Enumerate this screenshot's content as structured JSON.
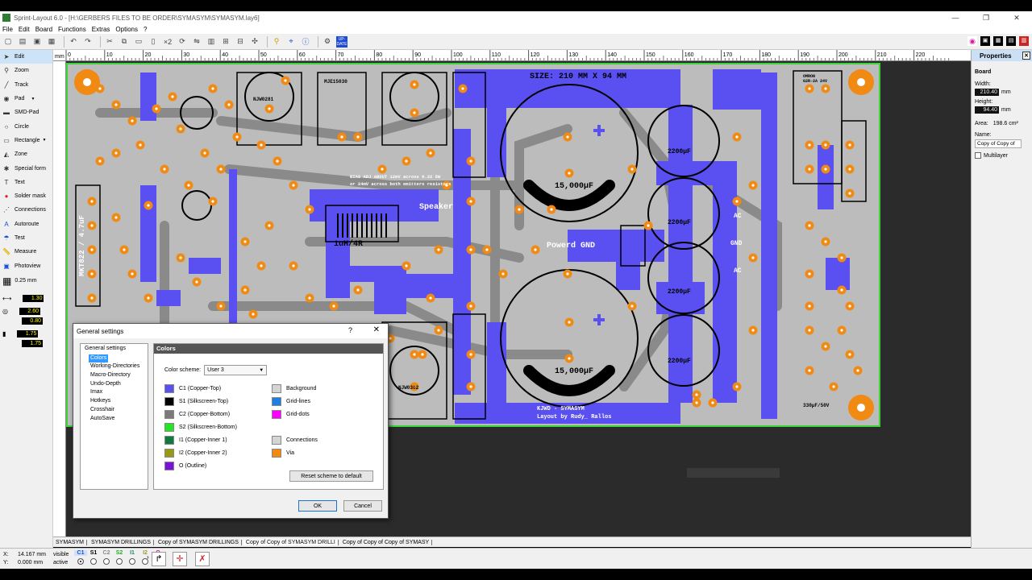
{
  "window": {
    "title": "Sprint-Layout 6.0 - [H:\\GERBERS FILES TO BE ORDER\\SYMASYM\\SYMASYM.lay6]",
    "min": "—",
    "max": "❐",
    "close": "✕"
  },
  "menu": [
    "File",
    "Edit",
    "Board",
    "Functions",
    "Extras",
    "Options",
    "?"
  ],
  "toolbar": {
    "zoom_label": "×2",
    "update_label": "UP-\nDATE"
  },
  "tools": [
    {
      "label": "Edit",
      "icon": "arrow-icon"
    },
    {
      "label": "Zoom",
      "icon": "zoom-icon"
    },
    {
      "label": "Track",
      "icon": "track-icon"
    },
    {
      "label": "Pad",
      "icon": "pad-icon"
    },
    {
      "label": "SMD-Pad",
      "icon": "smd-pad-icon"
    },
    {
      "label": "Circle",
      "icon": "circle-icon"
    },
    {
      "label": "Rectangle",
      "icon": "rectangle-icon"
    },
    {
      "label": "Zone",
      "icon": "zone-icon"
    },
    {
      "label": "Special form",
      "icon": "special-form-icon"
    },
    {
      "label": "Text",
      "icon": "text-icon"
    },
    {
      "label": "Solder mask",
      "icon": "solder-mask-icon"
    },
    {
      "label": "Connections",
      "icon": "connections-icon"
    },
    {
      "label": "Autoroute",
      "icon": "autoroute-icon"
    },
    {
      "label": "Test",
      "icon": "test-icon"
    },
    {
      "label": "Measure",
      "icon": "measure-icon"
    },
    {
      "label": "Photoview",
      "icon": "photoview-icon"
    }
  ],
  "grid": {
    "value": "0.25 mm"
  },
  "track_widths": [
    "1.30",
    "2.60",
    "0.80",
    "1.75",
    "1.75"
  ],
  "ruler": {
    "unit": "mm",
    "ticks": [
      "0",
      "10",
      "20",
      "30",
      "40",
      "50",
      "60",
      "70",
      "80",
      "90",
      "100",
      "110",
      "120",
      "130",
      "140",
      "150",
      "160",
      "170",
      "180",
      "190",
      "200",
      "210",
      "220"
    ]
  },
  "board_texts": {
    "size": "SIZE: 210 MM X 94 MM",
    "cap1": "15,000µF",
    "cap2": "15,000µF",
    "gnd": "Powerd GND",
    "speaker": "Speaker",
    "inductor": "1uH/4R",
    "mkt": "MKT822 / 4.7uF",
    "credit1": "KJWD - SYMASYM",
    "credit2": "Layout by Rudy_ Rallos",
    "c2200a": "2200µF",
    "c2200b": "2200µF",
    "c2200c": "2200µF",
    "c2200d": "2200µF",
    "bias": "BIAS ADJ ABOUT 12mV across 0.22 5W",
    "bias2": "or 24mV across both emitters resistors",
    "ac1": "AC",
    "ac2": "AC",
    "gnd2": "GND",
    "mje": "MJE15030",
    "njw1": "NJW0281",
    "njw2": "NJW0302",
    "cap330": "330µF/50V",
    "relay": "OMRON\nG2R-2A 24V"
  },
  "tabs": [
    "SYMASYM",
    "SYMASYM DRILLINGS",
    "Copy of SYMASYM DRILLINGS",
    "Copy of Copy of SYMASYM DRILLI",
    "Copy of Copy of Copy of SYMASY"
  ],
  "status": {
    "x_label": "X:",
    "x_value": "14.167 mm",
    "y_label": "Y:",
    "y_value": "0.000 mm",
    "visible": "visible",
    "active": "active",
    "layers": [
      "C1",
      "S1",
      "C2",
      "S2",
      "I1",
      "I2",
      "O"
    ],
    "layer_colors": [
      "#1e4fd8",
      "#000000",
      "#888888",
      "#1fb01f",
      "#1e8a5a",
      "#999933",
      "#d4169e"
    ]
  },
  "properties": {
    "title": "Properties",
    "section": "Board",
    "width_label": "Width:",
    "width_value": "210.40",
    "height_label": "Height:",
    "height_value": "94.40",
    "unit": "mm",
    "area_label": "Area:",
    "area_value": "198.6 cm²",
    "name_label": "Name:",
    "name_value": "Copy of Copy of",
    "multilayer_label": "Multilayer"
  },
  "dialog": {
    "title": "General settings",
    "help": "?",
    "close": "✕",
    "tree": [
      "General settings",
      "Colors",
      "Working-Directories",
      "Macro-Directory",
      "Undo-Depth",
      "Imax",
      "Hotkeys",
      "Crosshair",
      "AutoSave"
    ],
    "selected": "Colors",
    "panel_title": "Colors",
    "scheme_label": "Color scheme:",
    "scheme_value": "User 3",
    "colors_left": [
      {
        "label": "C1 (Copper-Top)",
        "color": "#5a4ff0"
      },
      {
        "label": "S1 (Silkscreen-Top)",
        "color": "#000000"
      },
      {
        "label": "C2 (Copper-Bottom)",
        "color": "#7a7a7a"
      },
      {
        "label": "S2 (Silkscreen-Bottom)",
        "color": "#22e622"
      },
      {
        "label": "I1 (Copper-Inner 1)",
        "color": "#0f7a3d"
      },
      {
        "label": "I2 (Copper-Inner 2)",
        "color": "#9a9a12"
      },
      {
        "label": "O (Outline)",
        "color": "#7b12d9"
      }
    ],
    "colors_right": [
      {
        "label": "Background",
        "color": "#d4d4d4"
      },
      {
        "label": "Grid-lines",
        "color": "#1f7ee0"
      },
      {
        "label": "Grid-dots",
        "color": "#ff00ff"
      },
      {
        "label": "",
        "color": ""
      },
      {
        "label": "Connections",
        "color": "#d4d4d4"
      },
      {
        "label": "Via",
        "color": "#f08a12"
      }
    ],
    "reset_button": "Reset scheme to default",
    "ok_button": "OK",
    "cancel_button": "Cancel"
  },
  "colors": {
    "copper_top": "#5a4ff0",
    "copper_bottom": "#8a8a8a",
    "pad": "#f08a12",
    "board_bg": "#bcbcbc",
    "outline": "#3bd43b",
    "annotation": "#e21fd2"
  }
}
